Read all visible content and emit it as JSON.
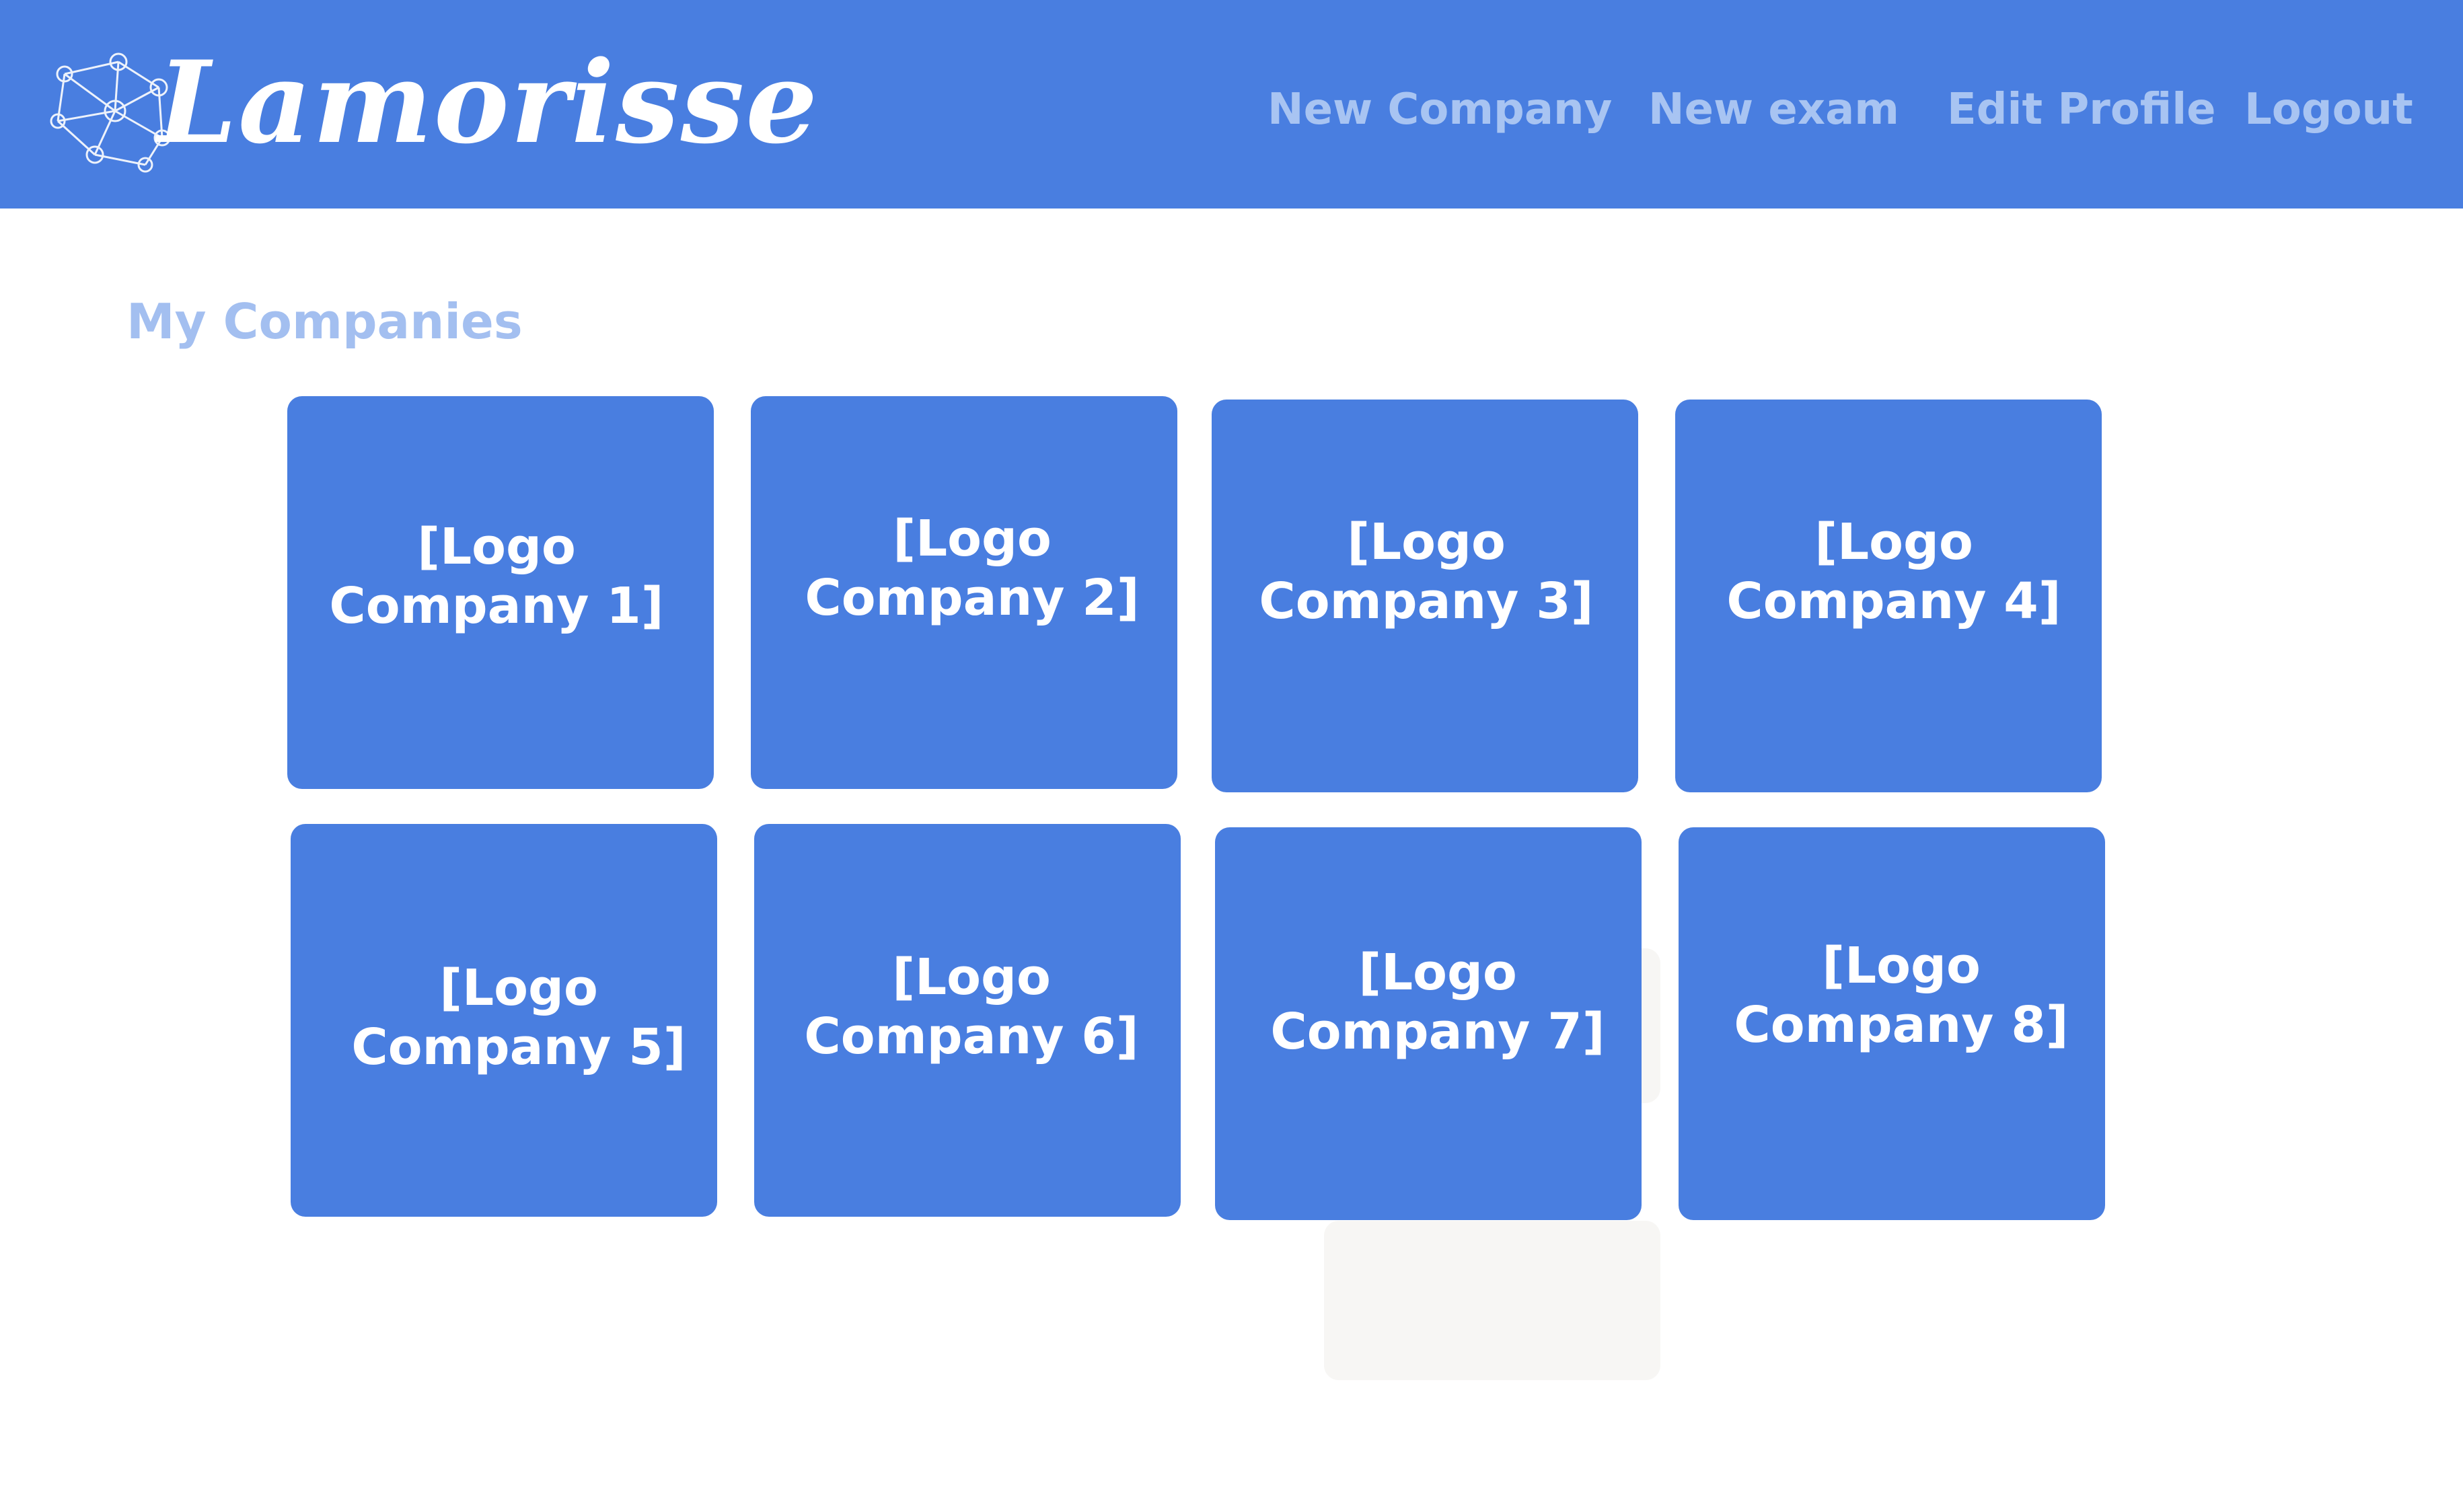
{
  "brand": {
    "name": "Lamorisse",
    "logo_icon": "network-graph-icon",
    "color": "#497ee0"
  },
  "nav": {
    "new_company": "New Company",
    "new_exam": "New exam",
    "edit_profile": "Edit Profile",
    "logout": "Logout",
    "link_color": "#a8c4f2"
  },
  "main": {
    "title": "My Companies",
    "companies": [
      {
        "label": "[Logo\nCompany 1]"
      },
      {
        "label": "[Logo\nCompany 2]"
      },
      {
        "label": "[Logo\nCompany 3]"
      },
      {
        "label": "[Logo\nCompany 4]"
      },
      {
        "label": "[Logo\nCompany 5]"
      },
      {
        "label": "[Logo\nCompany 6]"
      },
      {
        "label": "[Logo\nCompany 7]"
      },
      {
        "label": "[Logo\nCompany 8]"
      }
    ]
  }
}
